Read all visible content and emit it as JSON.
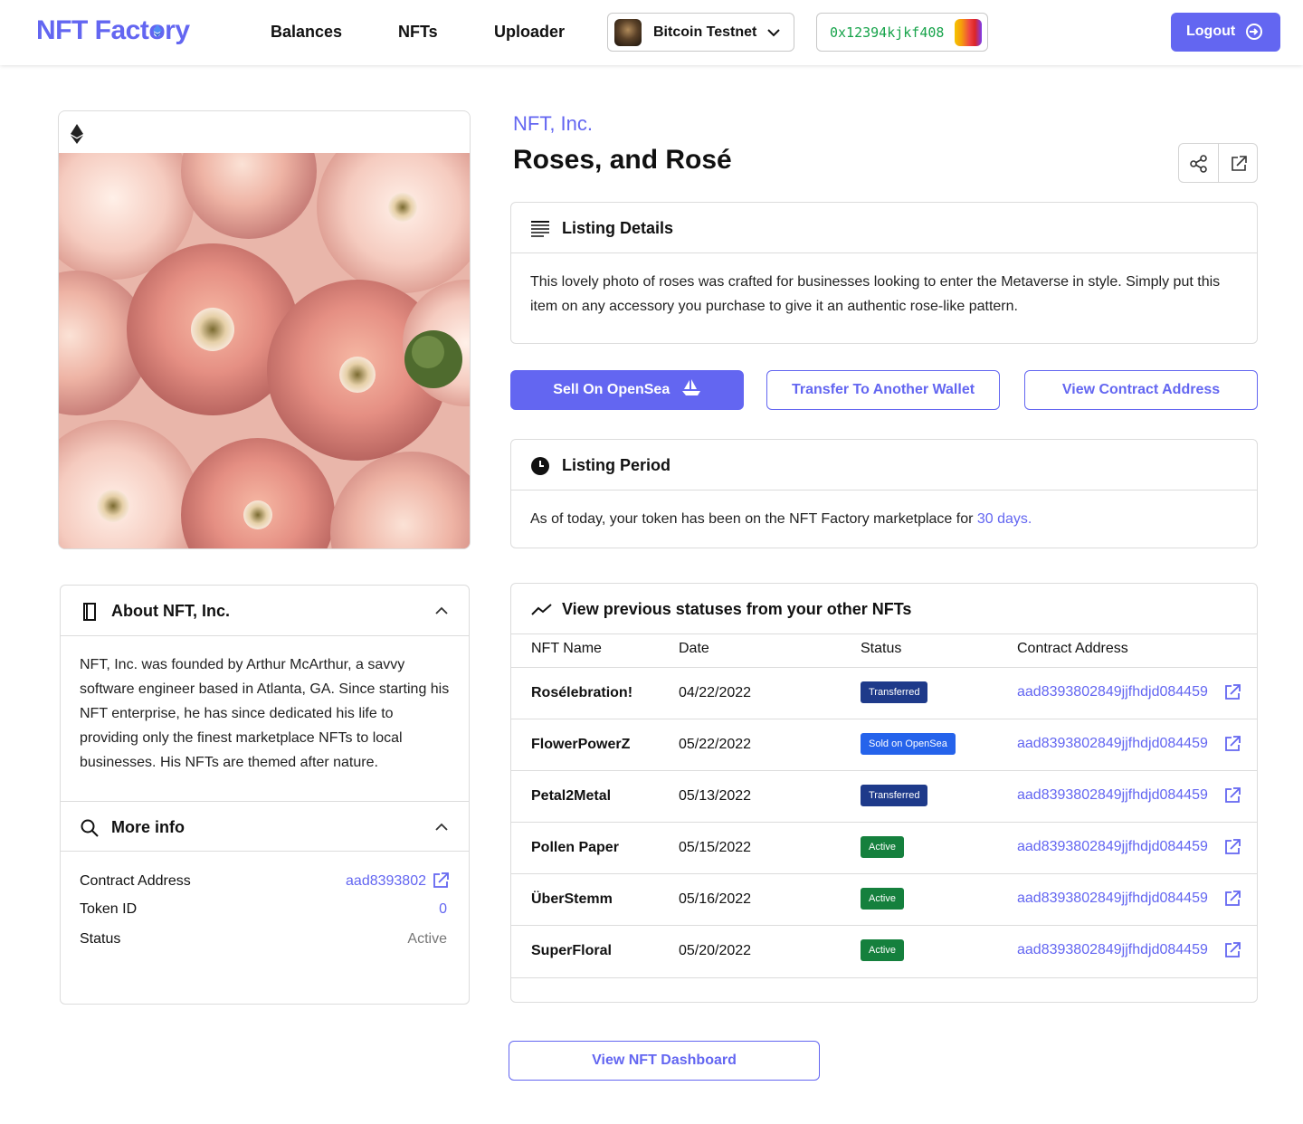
{
  "header": {
    "logo": "NFT Factory",
    "nav": [
      "Balances",
      "NFTs",
      "Uploader"
    ],
    "network": "Bitcoin Testnet",
    "wallet_address": "0x12394kjkf408",
    "logout_label": "Logout"
  },
  "nft": {
    "brand": "NFT, Inc.",
    "title": "Roses, and Rosé"
  },
  "listing_details": {
    "heading": "Listing Details",
    "text": "This lovely photo of roses was crafted for businesses looking to enter the Metaverse in style. Simply put this item on any accessory you purchase to give it an authentic rose-like pattern."
  },
  "actions": {
    "sell": "Sell On OpenSea",
    "transfer": "Transfer To Another Wallet",
    "view_contract": "View Contract Address"
  },
  "listing_period": {
    "heading": "Listing Period",
    "text": "As of today, your token has been on the NFT Factory marketplace for",
    "days": "30 days."
  },
  "about": {
    "heading": "About NFT, Inc.",
    "text": "NFT, Inc. was founded by Arthur McArthur, a savvy software engineer based in Atlanta, GA. Since starting his NFT enterprise, he has since dedicated his life to providing only the finest marketplace NFTs to local businesses. His NFTs are themed after nature."
  },
  "more_info": {
    "heading": "More info",
    "contract_label": "Contract Address",
    "contract_value": "aad8393802",
    "token_label": "Token ID",
    "token_value": "0",
    "status_label": "Status",
    "status_value": "Active"
  },
  "history": {
    "heading": "View previous statuses from your other NFTs",
    "columns": [
      "NFT Name",
      "Date",
      "Status",
      "Contract Address"
    ],
    "rows": [
      {
        "name": "Rosélebration!",
        "date": "04/22/2022",
        "status": "Transferred",
        "address": "aad8393802849jjfhdjd084459"
      },
      {
        "name": "FlowerPowerZ",
        "date": "05/22/2022",
        "status": "Sold on OpenSea",
        "address": "aad8393802849jjfhdjd084459"
      },
      {
        "name": "Petal2Metal",
        "date": "05/13/2022",
        "status": "Transferred",
        "address": "aad8393802849jjfhdjd084459"
      },
      {
        "name": "Pollen Paper",
        "date": "05/15/2022",
        "status": "Active",
        "address": "aad8393802849jjfhdjd084459"
      },
      {
        "name": "ÜberStemm",
        "date": "05/16/2022",
        "status": "Active",
        "address": "aad8393802849jjfhdjd084459"
      },
      {
        "name": "SuperFloral",
        "date": "05/20/2022",
        "status": "Active",
        "address": "aad8393802849jjfhdjd084459"
      }
    ],
    "status_colors": {
      "Transferred": "#1e3a8a",
      "Sold on OpenSea": "#2563eb",
      "Active": "#15803d"
    }
  },
  "footer": {
    "dashboard_label": "View NFT Dashboard"
  },
  "colors": {
    "accent": "#6366f1",
    "wallet_text": "#16a34a"
  }
}
